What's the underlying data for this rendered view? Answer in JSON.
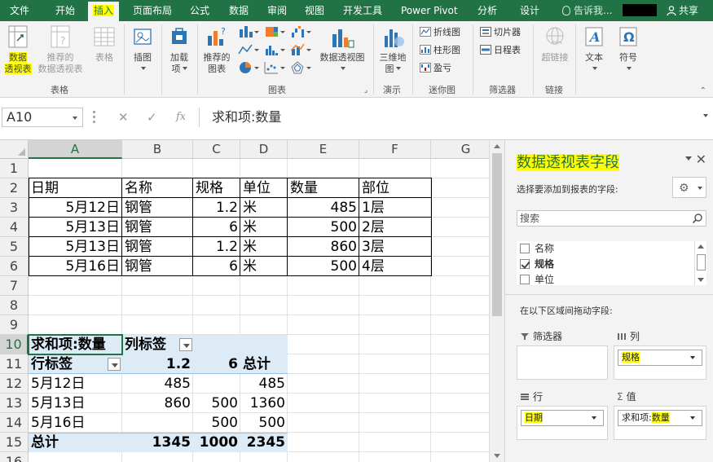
{
  "tabs": [
    "文件",
    "开始",
    "插入",
    "页面布局",
    "公式",
    "数据",
    "审阅",
    "视图",
    "开发工具",
    "Power Pivot",
    "分析",
    "设计"
  ],
  "tell_me": "告诉我...",
  "share": "共享",
  "ribbon": {
    "pivot_table_1": "数据",
    "pivot_table_2": "透视表",
    "recommended_pivot_1": "推荐的",
    "recommended_pivot_2": "数据透视表",
    "table": "表格",
    "group_tables": "表格",
    "illustrations": "插图",
    "addins_1": "加载",
    "addins_2": "项",
    "recommended_charts_1": "推荐的",
    "recommended_charts_2": "图表",
    "pivot_chart": "数据透视图",
    "group_charts": "图表",
    "map3d_1": "三维地",
    "map3d_2": "图",
    "group_tours": "演示",
    "spark_line": "折线图",
    "spark_column": "柱形图",
    "spark_winloss": "盈亏",
    "group_sparklines": "迷你图",
    "slicer": "切片器",
    "timeline": "日程表",
    "group_filters": "筛选器",
    "hyperlink": "超链接",
    "group_links": "链接",
    "text": "文本",
    "symbol": "符号"
  },
  "formula_bar": {
    "name_box": "A10",
    "formula": "求和项:数量"
  },
  "grid": {
    "columns": [
      "A",
      "B",
      "C",
      "D",
      "E",
      "F",
      "G"
    ],
    "rows": [
      "1",
      "2",
      "3",
      "4",
      "5",
      "6",
      "7",
      "8",
      "9",
      "10",
      "11",
      "12",
      "13",
      "14",
      "15",
      "16"
    ],
    "data_table": {
      "headers": [
        "日期",
        "名称",
        "规格",
        "单位",
        "数量",
        "部位"
      ],
      "rows": [
        [
          "5月12日",
          "钢管",
          "1.2",
          "米",
          "485",
          "1层"
        ],
        [
          "5月13日",
          "钢管",
          "6",
          "米",
          "500",
          "2层"
        ],
        [
          "5月13日",
          "钢管",
          "1.2",
          "米",
          "860",
          "3层"
        ],
        [
          "5月16日",
          "钢管",
          "6",
          "米",
          "500",
          "4层"
        ]
      ]
    },
    "pivot": {
      "value_label": "求和项:数量",
      "col_label": "列标签",
      "row_label": "行标签",
      "col_values": [
        "1.2",
        "6",
        "总计"
      ],
      "rows": [
        [
          "5月12日",
          "485",
          "",
          "485"
        ],
        [
          "5月13日",
          "860",
          "500",
          "1360"
        ],
        [
          "5月16日",
          "",
          "500",
          "500"
        ]
      ],
      "total": [
        "总计",
        "1345",
        "1000",
        "2345"
      ]
    }
  },
  "pane": {
    "title": "数据透视表字段",
    "subtitle": "选择要添加到报表的字段:",
    "search_placeholder": "搜索",
    "fields": [
      {
        "name": "名称",
        "checked": false
      },
      {
        "name": "规格",
        "checked": true
      },
      {
        "name": "单位",
        "checked": false
      }
    ],
    "drag_label": "在以下区域间拖动字段:",
    "filters_label": "筛选器",
    "columns_label": "列",
    "rows_label": "行",
    "values_label": "值",
    "columns_field": "规格",
    "rows_field": "日期",
    "values_field_prefix": "求和项:",
    "values_field_name": "数量"
  }
}
